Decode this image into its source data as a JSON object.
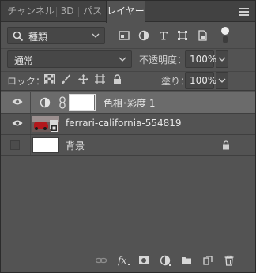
{
  "tabs": [
    {
      "label": "チャンネル"
    },
    {
      "label": "3D"
    },
    {
      "label": "パス"
    },
    {
      "label": "レイヤー"
    }
  ],
  "filter": {
    "kind_label": "種類",
    "icons": [
      "pixel-filter-icon",
      "adjustment-filter-icon",
      "type-filter-icon",
      "shape-filter-icon",
      "smart-object-filter-icon"
    ]
  },
  "blend": {
    "mode": "通常",
    "opacity_label": "不透明度：",
    "opacity_value": "100%"
  },
  "lock": {
    "label": "ロック：",
    "fill_label": "塗り：",
    "fill_value": "100%"
  },
  "layers": [
    {
      "name": "色相･彩度 1",
      "visible": true,
      "selected": true
    },
    {
      "name": "ferrari-california-554819",
      "visible": true,
      "selected": false
    },
    {
      "name": "背景",
      "visible": false,
      "selected": false,
      "locked": true
    }
  ],
  "colors": {
    "panel_bg": "#535353",
    "selected_row": "#6b6b6b",
    "tab_bar": "#424242"
  }
}
